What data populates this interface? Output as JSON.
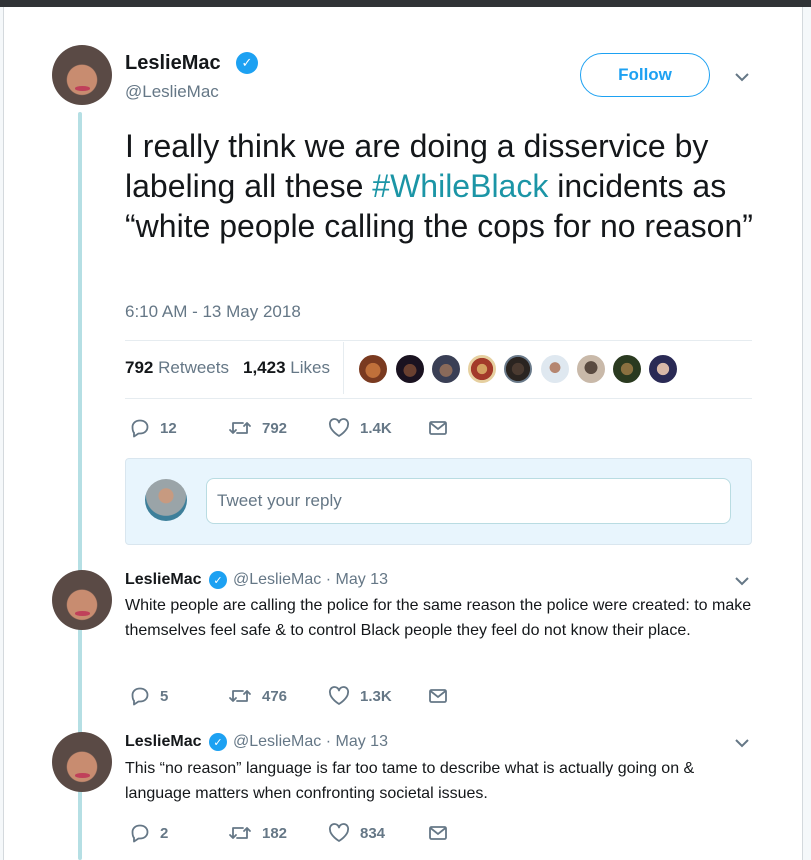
{
  "main_tweet": {
    "author_name": "LeslieMac",
    "handle": "@LeslieMac",
    "follow_label": "Follow",
    "text_before": "I really think we are doing a disservice by labeling all these ",
    "hashtag": "#WhileBlack",
    "text_after": " incidents as “white people calling the cops for no reason”",
    "timestamp": "6:10 AM - 13 May 2018",
    "retweets_count": "792",
    "retweets_label": "Retweets",
    "likes_count": "1,423",
    "likes_label": "Likes",
    "actions": {
      "replies": "12",
      "retweets": "792",
      "likes": "1.4K"
    }
  },
  "reply_box": {
    "placeholder": "Tweet your reply"
  },
  "replies": [
    {
      "author_name": "LeslieMac",
      "handle_date": "@LeslieMac · May 13",
      "text": "White people are calling the police for the same reason the police were created: to make themselves feel safe & to control Black people they feel do not know their place.",
      "actions": {
        "replies": "5",
        "retweets": "476",
        "likes": "1.3K"
      }
    },
    {
      "author_name": "LeslieMac",
      "handle_date": "@LeslieMac · May 13",
      "text": "This “no reason” language is far too tame to describe what is actually going on & language matters when confronting societal issues.",
      "actions": {
        "replies": "2",
        "retweets": "182",
        "likes": "834"
      }
    }
  ],
  "colors": {
    "accent": "#1da1f2",
    "hashtag": "#1b95a6",
    "thread_line": "#b5dfe4",
    "muted": "#657786"
  }
}
